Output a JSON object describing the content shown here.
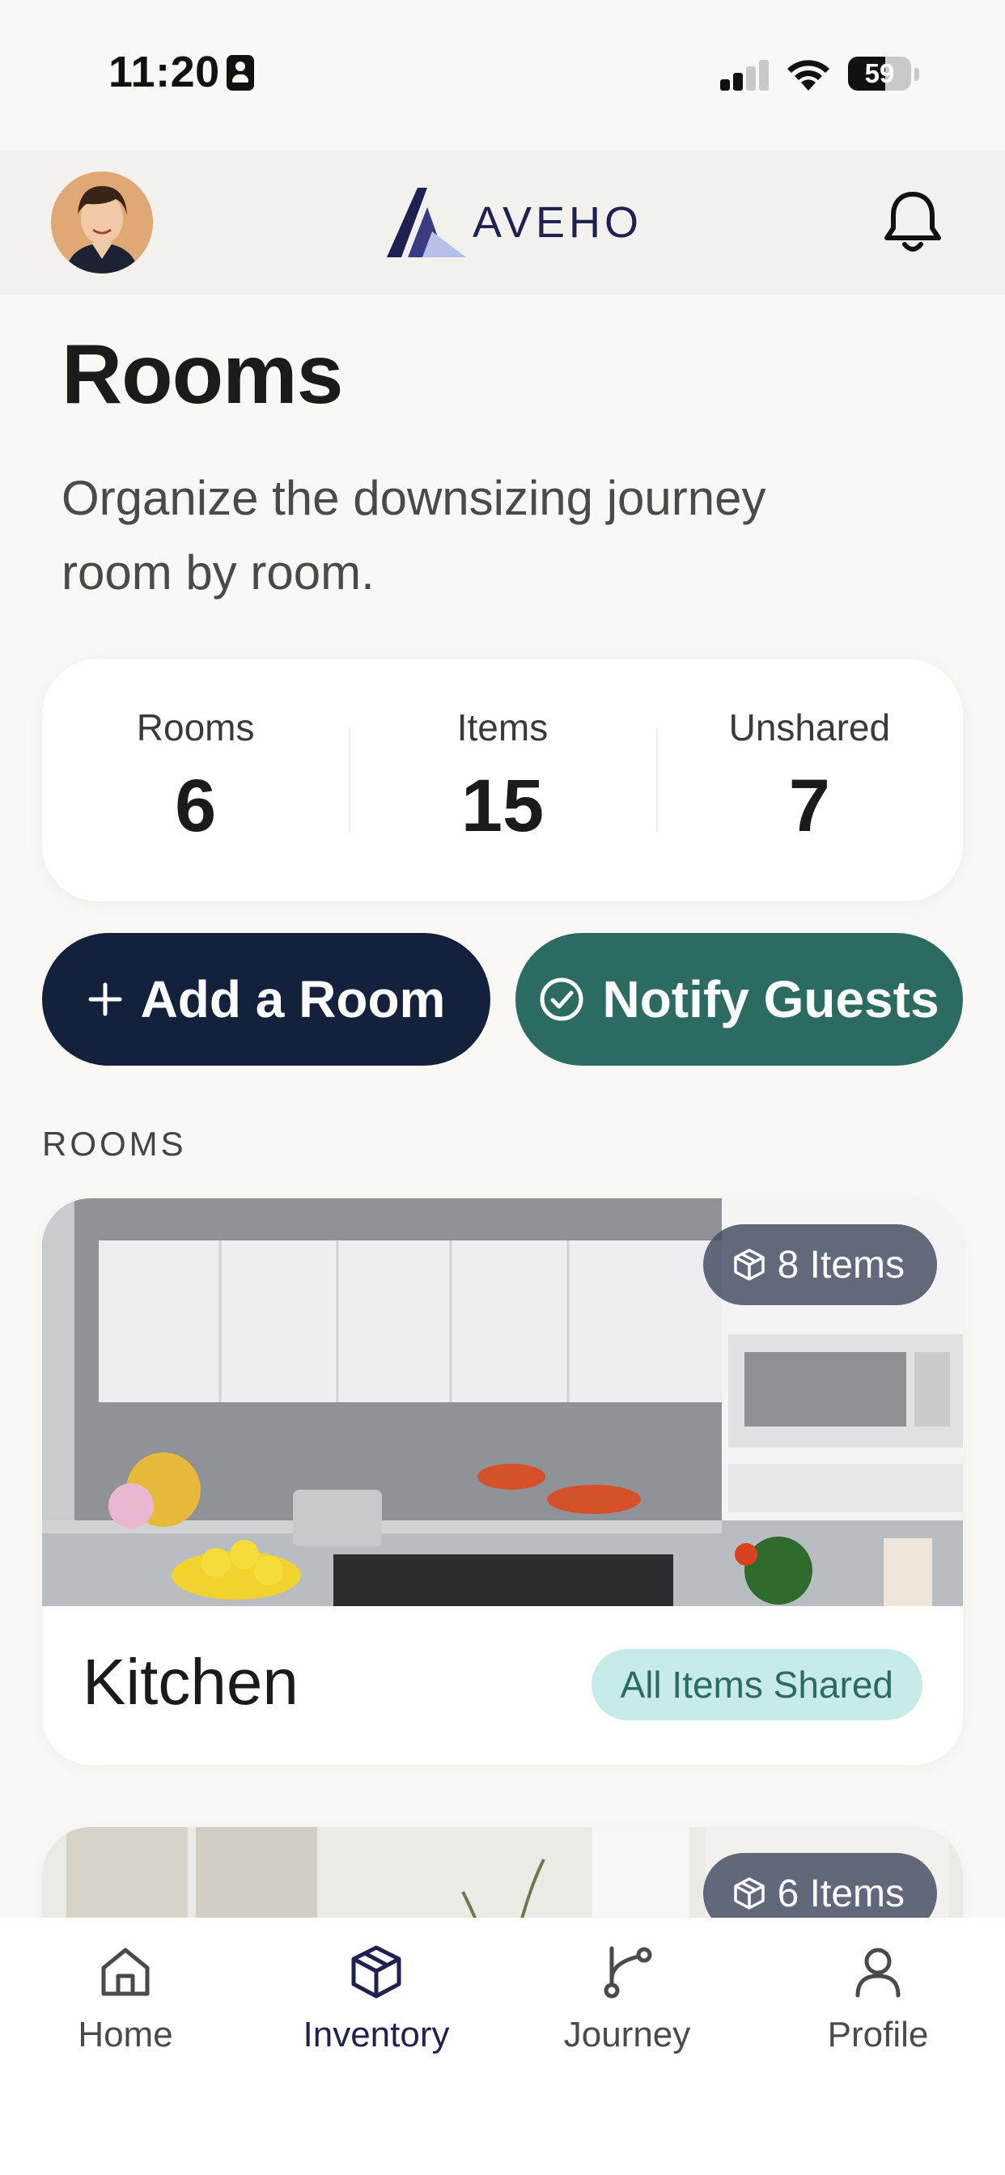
{
  "status_bar": {
    "time": "11:20",
    "battery": "59",
    "battery_level": 0.59
  },
  "header": {
    "logo_text": "AVEHO",
    "avatar_icon": "user-avatar",
    "notification_icon": "bell-icon"
  },
  "page": {
    "title": "Rooms",
    "subtitle": "Organize the downsizing journey room by room."
  },
  "stats": [
    {
      "label": "Rooms",
      "value": "6"
    },
    {
      "label": "Items",
      "value": "15"
    },
    {
      "label": "Unshared",
      "value": "7"
    }
  ],
  "actions": {
    "add_room": "Add a Room",
    "notify_guests": "Notify Guests"
  },
  "section_label": "ROOMS",
  "rooms": [
    {
      "name": "Kitchen",
      "items": "8 Items",
      "status": "All Items Shared"
    },
    {
      "items": "6 Items"
    }
  ],
  "nav": [
    {
      "label": "Home",
      "icon": "home-icon"
    },
    {
      "label": "Inventory",
      "icon": "box-icon",
      "active": true
    },
    {
      "label": "Journey",
      "icon": "route-icon"
    },
    {
      "label": "Profile",
      "icon": "user-icon"
    }
  ],
  "colors": {
    "primary_navy": "#13213d",
    "teal": "#2b6b62",
    "badge_bg": "#c7ebe8",
    "background": "#f9f8f5"
  }
}
